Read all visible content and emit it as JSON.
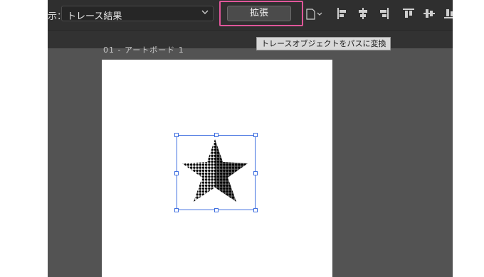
{
  "control_bar": {
    "view_label": "示：",
    "view_value": "トレース結果",
    "expand_button": "拡張",
    "tooltip": "トレースオブジェクトをパスに変換"
  },
  "artboard": {
    "label": "01 - アートボード 1"
  },
  "colors": {
    "highlight": "#e0569a",
    "selection": "#3f6fe0",
    "panel_bg": "#2f2f2f",
    "canvas_bg": "#535353"
  },
  "icons": [
    "chevron-down-icon",
    "document-icon",
    "align-left-icon",
    "align-hcenter-icon",
    "align-right-icon",
    "align-top-icon",
    "align-vcenter-icon",
    "align-bottom-icon"
  ]
}
